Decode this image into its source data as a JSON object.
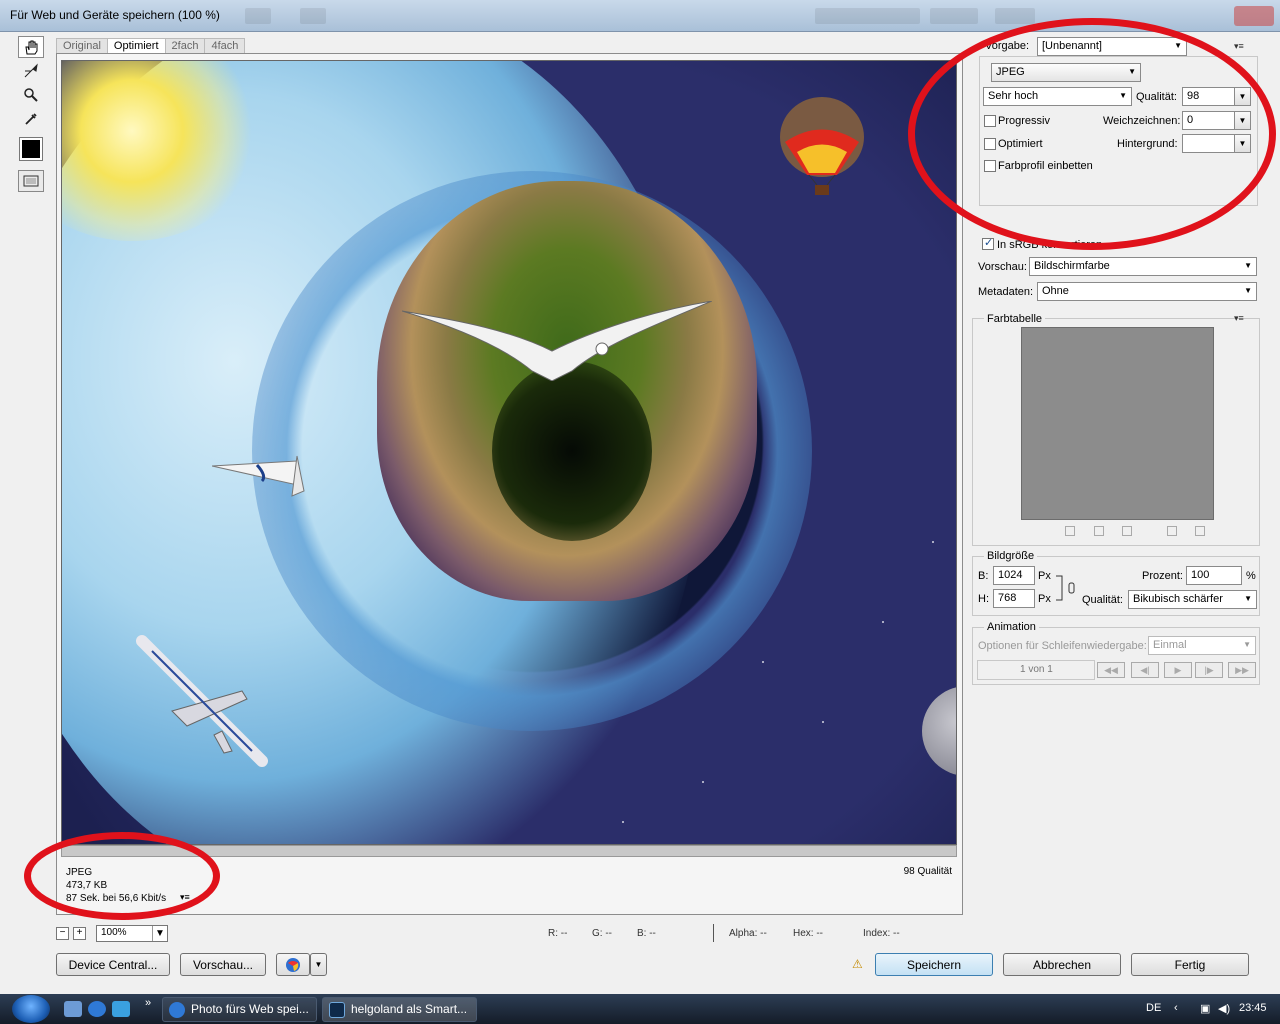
{
  "window": {
    "title": "Für Web und Geräte speichern (100 %)"
  },
  "tabs": [
    "Original",
    "Optimiert",
    "2fach",
    "4fach"
  ],
  "active_tab": "Optimiert",
  "info": {
    "format": "JPEG",
    "size": "473,7 KB",
    "time": "87 Sek. bei 56,6 Kbit/s",
    "quality": "98 Qualität"
  },
  "zoom": {
    "value": "100%"
  },
  "pixel_info": {
    "r": "R: --",
    "g": "G: --",
    "b": "B: --",
    "alpha": "Alpha: --",
    "hex": "Hex: --",
    "index": "Index: --"
  },
  "buttons": {
    "device_central": "Device Central...",
    "preview": "Vorschau...",
    "save": "Speichern",
    "cancel": "Abbrechen",
    "done": "Fertig"
  },
  "settings": {
    "preset_label": "Vorgabe:",
    "preset_value": "[Unbenannt]",
    "format_value": "JPEG",
    "quality_preset": "Sehr hoch",
    "quality_label": "Qualität:",
    "quality_value": "98",
    "progressive_label": "Progressiv",
    "blur_label": "Weichzeichnen:",
    "blur_value": "0",
    "optimized_label": "Optimiert",
    "matte_label": "Hintergrund:",
    "embed_profile_label": "Farbprofil einbetten",
    "srgb_label": "In sRGB konvertieren",
    "preview_label": "Vorschau:",
    "preview_value": "Bildschirmfarbe",
    "metadata_label": "Metadaten:",
    "metadata_value": "Ohne"
  },
  "color_table": {
    "title": "Farbtabelle"
  },
  "image_size": {
    "title": "Bildgröße",
    "width_label": "B:",
    "width_value": "1024",
    "height_label": "H:",
    "height_value": "768",
    "unit": "Px",
    "percent_label": "Prozent:",
    "percent_value": "100",
    "percent_unit": "%",
    "quality_label": "Qualität:",
    "quality_value": "Bikubisch schärfer"
  },
  "animation": {
    "title": "Animation",
    "loop_label": "Optionen für Schleifenwiedergabe:",
    "loop_value": "Einmal",
    "frame_counter": "1 von 1"
  },
  "taskbar": {
    "items": [
      "Photo fürs Web spei...",
      "helgoland als Smart..."
    ],
    "language": "DE",
    "clock": "23:45"
  },
  "colors": {
    "annotation": "#e0121b",
    "accent": "#3c7fb1"
  }
}
